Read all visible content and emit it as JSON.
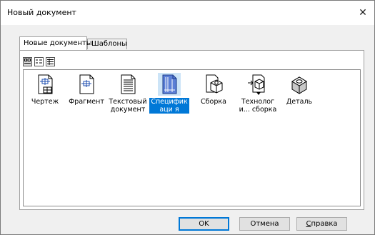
{
  "window": {
    "title": "Новый документ",
    "close": "✕"
  },
  "tabs": [
    {
      "label": "Новые документы"
    },
    {
      "label": "Шаблоны"
    }
  ],
  "view_buttons": [
    "large-icons",
    "list",
    "details"
  ],
  "items": [
    {
      "label": "Чертеж",
      "icon": "drawing-icon"
    },
    {
      "label": "Фрагмент",
      "icon": "fragment-icon"
    },
    {
      "label": "Текстовый документ",
      "icon": "text-document-icon"
    },
    {
      "label": "Спецификаци я",
      "icon": "specification-icon",
      "selected": true
    },
    {
      "label": "Сборка",
      "icon": "assembly-icon"
    },
    {
      "label": "Технологи... сборка",
      "icon": "tech-assembly-icon"
    },
    {
      "label": "Деталь",
      "icon": "part-icon"
    }
  ],
  "buttons": {
    "ok": "OK",
    "cancel": "Отмена",
    "help_underlined": "С",
    "help_rest": "правка"
  },
  "colors": {
    "selection": "#0078d7",
    "accent": "#0078d7"
  }
}
